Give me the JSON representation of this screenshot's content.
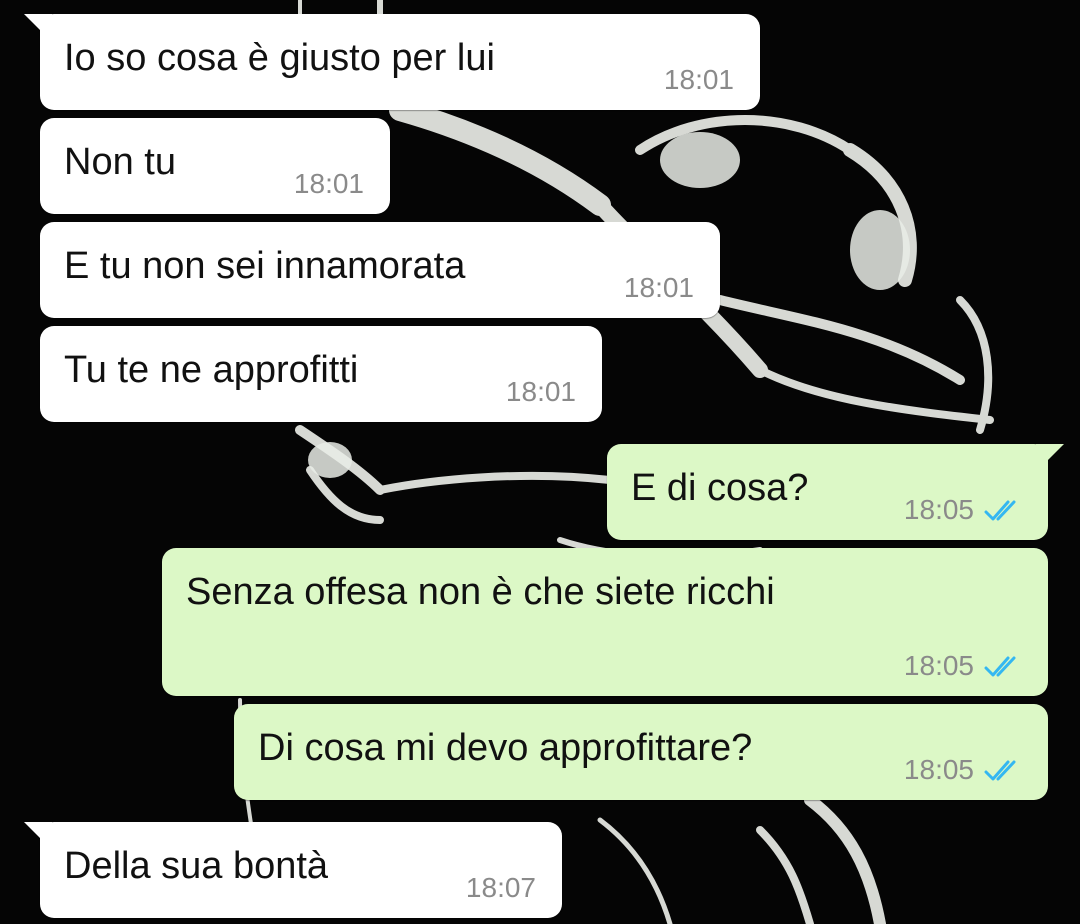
{
  "theme": {
    "incoming_bg": "#ffffff",
    "outgoing_bg": "#dcf8c6",
    "text_color": "#111111",
    "time_color": "#8a8a8a",
    "read_tick_color": "#34b7f1",
    "wallpaper_bg": "#050505"
  },
  "wallpaper": {
    "description_icon": "monochrome-figure-wallpaper"
  },
  "messages": [
    {
      "direction": "incoming",
      "text": "Io so cosa è giusto per lui",
      "time": "18:01"
    },
    {
      "direction": "incoming",
      "text": "Non tu",
      "time": "18:01"
    },
    {
      "direction": "incoming",
      "text": "E tu non sei innamorata",
      "time": "18:01"
    },
    {
      "direction": "incoming",
      "text": "Tu te ne approfitti",
      "time": "18:01"
    },
    {
      "direction": "outgoing",
      "text": "E di cosa?",
      "time": "18:05",
      "status": "read-double-check-icon"
    },
    {
      "direction": "outgoing",
      "text": "Senza offesa non è che siete ricchi",
      "time": "18:05",
      "status": "read-double-check-icon"
    },
    {
      "direction": "outgoing",
      "text": "Di cosa mi devo approfittare?",
      "time": "18:05",
      "status": "read-double-check-icon"
    },
    {
      "direction": "incoming",
      "text": "Della sua bontà",
      "time": "18:07"
    }
  ]
}
